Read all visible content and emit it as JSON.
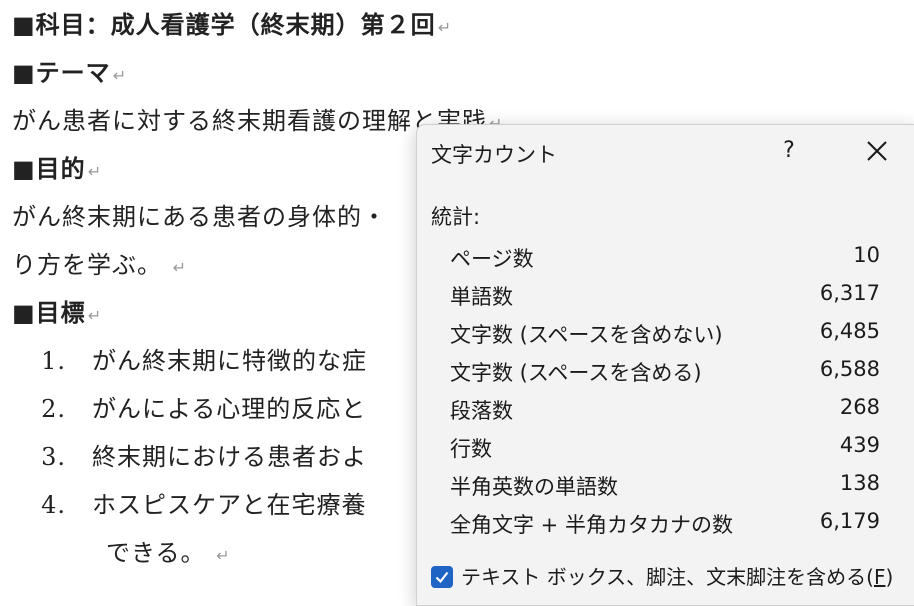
{
  "document": {
    "lines": [
      {
        "text": "■科目：成人看護学（終末期）第２回",
        "bold": true
      },
      {
        "text": "■テーマ",
        "bold": true
      },
      {
        "text": "がん患者に対する終末期看護の理解と実践",
        "bold": false
      },
      {
        "text": "■目的",
        "bold": true
      },
      {
        "text": "がん終末期にある患者の身体的・",
        "bold": false
      },
      {
        "text": "り方を学ぶ。",
        "bold": false
      },
      {
        "text": "■目標",
        "bold": true
      }
    ],
    "list_items": [
      {
        "num": "1.",
        "text": "がん終末期に特徴的な症"
      },
      {
        "num": "2.",
        "text": "がんによる心理的反応と"
      },
      {
        "num": "3.",
        "text": "終末期における患者およ"
      },
      {
        "num": "4.",
        "text": "ホスピスケアと在宅療養"
      }
    ],
    "continuation": "できる。",
    "paragraph_mark": "↵"
  },
  "dialog": {
    "title": "文字カウント",
    "help_label": "?",
    "section_label": "統計:",
    "stats": [
      {
        "label": "ページ数",
        "value": "10"
      },
      {
        "label": "単語数",
        "value": "6,317"
      },
      {
        "label": "文字数 (スペースを含めない)",
        "value": "6,485"
      },
      {
        "label": "文字数 (スペースを含める)",
        "value": "6,588"
      },
      {
        "label": "段落数",
        "value": "268"
      },
      {
        "label": "行数",
        "value": "439"
      },
      {
        "label": "半角英数の単語数",
        "value": "138"
      },
      {
        "label": "全角文字 + 半角カタカナの数",
        "value": "6,179"
      }
    ],
    "checkbox": {
      "label": "テキスト ボックス、脚注、文末脚注を含める(",
      "accel": "F",
      "suffix": ")",
      "checked": true
    }
  },
  "colors": {
    "checkbox": "#1f63c5",
    "dialog_bg": "#f3f3f3"
  }
}
